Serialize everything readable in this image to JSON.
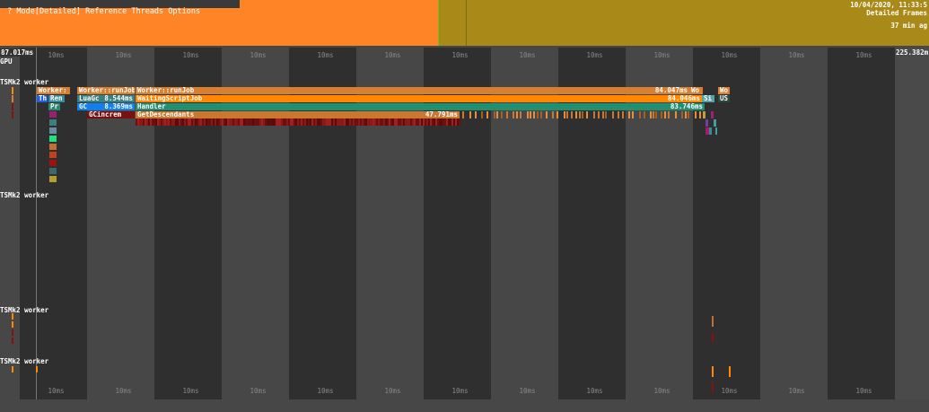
{
  "menu": {
    "items": [
      "?",
      "Mode[Detailed]",
      "Reference",
      "Threads",
      "Options"
    ]
  },
  "header": {
    "date": "10/04/2020, 11:33:5",
    "mode": "Detailed Frames",
    "ago": "37 min ag"
  },
  "colors": {
    "frame_orange": "#ff8426",
    "frame_olive": "#a98a18"
  },
  "timeline": {
    "start": "87.017ms",
    "end": "225.382m",
    "tick": "10ms"
  },
  "threads": {
    "gpu": "GPU",
    "workers": [
      "TSMk2 worker",
      "TSMk2 worker",
      "TSMk2 worker",
      "TSMk2 worker"
    ]
  },
  "bars": [
    {
      "label": "Worker:",
      "time": "",
      "row": 0,
      "c": "#d98030"
    },
    {
      "label": "Worker::runJob",
      "time": "",
      "row": 0,
      "c": "#d98030"
    },
    {
      "label": "Worker::runJob",
      "time": "84.047ms",
      "row": 0,
      "c": "#d98030"
    },
    {
      "label": "Wo",
      "time": "",
      "row": 0,
      "c": "#d98030"
    },
    {
      "label": "Wo",
      "time": "",
      "row": 0,
      "c": "#d98030"
    },
    {
      "label": "Th",
      "time": "",
      "row": 1,
      "c": "#2060e0"
    },
    {
      "label": "Ren",
      "time": "",
      "row": 1,
      "c": "#3a8a9a"
    },
    {
      "label": "LuaGc",
      "time": "8.544ms",
      "row": 1,
      "c": "#3a8080"
    },
    {
      "label": "WaitingScriptJob",
      "time": "84.046ms",
      "row": 1,
      "c": "#ff8800"
    },
    {
      "label": "Si",
      "time": "",
      "row": 1,
      "c": "#5aa0a8"
    },
    {
      "label": "US",
      "time": "",
      "row": 1,
      "c": "#2a4a40"
    },
    {
      "label": "Pr",
      "time": "",
      "row": 2,
      "c": "#2a8a70"
    },
    {
      "label": "GC",
      "time": "8.369ms",
      "row": 2,
      "c": "#1080f0"
    },
    {
      "label": "Handler",
      "time": "83.746ms",
      "row": 2,
      "c": "#209070"
    },
    {
      "label": "GCincrem",
      "time": "",
      "row": 3,
      "c": "#7a1010"
    },
    {
      "label": "GetDescendants",
      "time": "47.791ms",
      "row": 3,
      "c": "#c87830"
    }
  ]
}
